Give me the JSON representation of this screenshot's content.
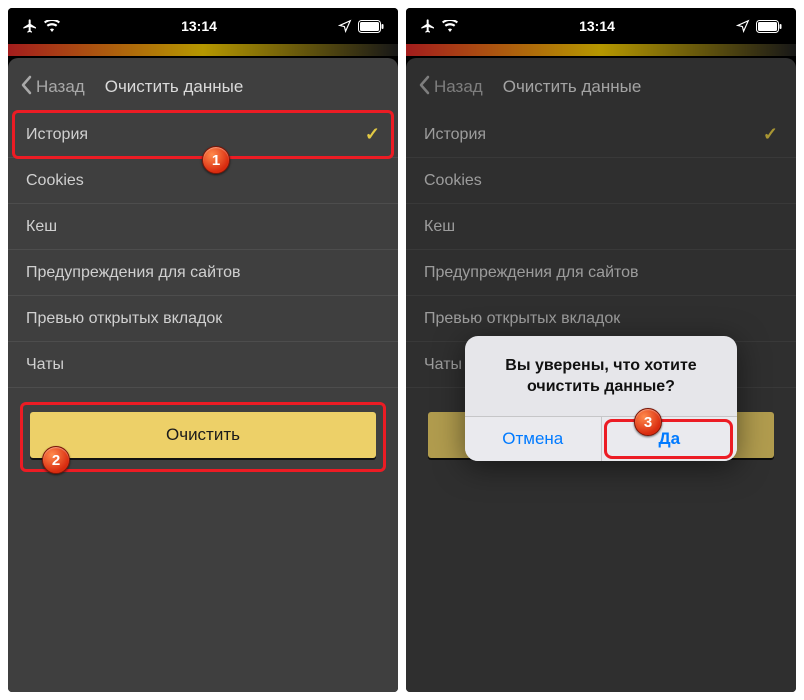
{
  "status": {
    "time": "13:14"
  },
  "nav": {
    "back": "Назад",
    "title": "Очистить данные"
  },
  "items": {
    "history": "История",
    "cookies": "Cookies",
    "cache": "Кеш",
    "warnings": "Предупреждения для сайтов",
    "previews": "Превью открытых вкладок",
    "chats": "Чаты"
  },
  "clear_button": "Очистить",
  "alert": {
    "message_l1": "Вы уверены, что хотите",
    "message_l2": "очистить данные?",
    "cancel": "Отмена",
    "confirm": "Да"
  },
  "annotations": {
    "n1": "1",
    "n2": "2",
    "n3": "3"
  }
}
